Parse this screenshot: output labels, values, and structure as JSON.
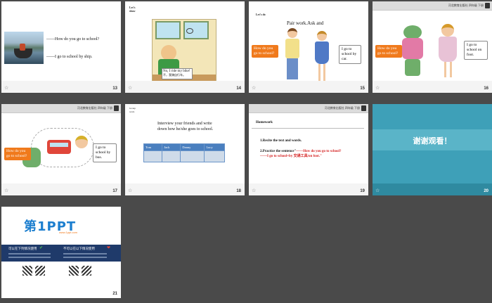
{
  "header_text": "河北教育出版社  四年级  下册",
  "slides": [
    {
      "number": "13",
      "line1": "——How do you go to school?",
      "line2": "——I go to school by ship."
    },
    {
      "number": "14",
      "title": "Let's show",
      "caption_en": "No, I ride my bike!",
      "caption_cn": "不，我骑自行车。"
    },
    {
      "number": "15",
      "title": "Let's do",
      "heading": "Pair work.Ask and",
      "question": "How do you go to school?",
      "answer": "I go to school by car."
    },
    {
      "number": "16",
      "question": "How do you go to school?",
      "answer": "I go to school on foot."
    },
    {
      "number": "17",
      "question": "How do you go to school?",
      "answer": "I go to school by bus."
    },
    {
      "number": "18",
      "title": "Group work",
      "instruction": "Interview your friends and write down how he/she goes to school.",
      "names": [
        "Tom",
        "Jack",
        "Danny",
        "Lucy"
      ]
    },
    {
      "number": "19",
      "heading": "Homework",
      "item1": "1.Recite the text and words.",
      "item2_prefix": "2.Practice the sentence\"",
      "item2_q": "——How do you go to school?",
      "item2_a": "——I go to school+by 交通工具/on foot.\""
    },
    {
      "number": "20",
      "thanks": "谢谢观看！"
    },
    {
      "number": "21",
      "logo": "第1PPT",
      "logo_url": "www.1ppt.com",
      "left_heading": "可以在下列情况使用",
      "right_heading": "不可以在以下情况使用"
    }
  ],
  "colors": {
    "orange": "#f07a1c",
    "teal": "#3ea0b8",
    "table_blue": "#4a7fbf",
    "ppt_blue": "#1d7fcf",
    "navy": "#1f3a6a"
  }
}
